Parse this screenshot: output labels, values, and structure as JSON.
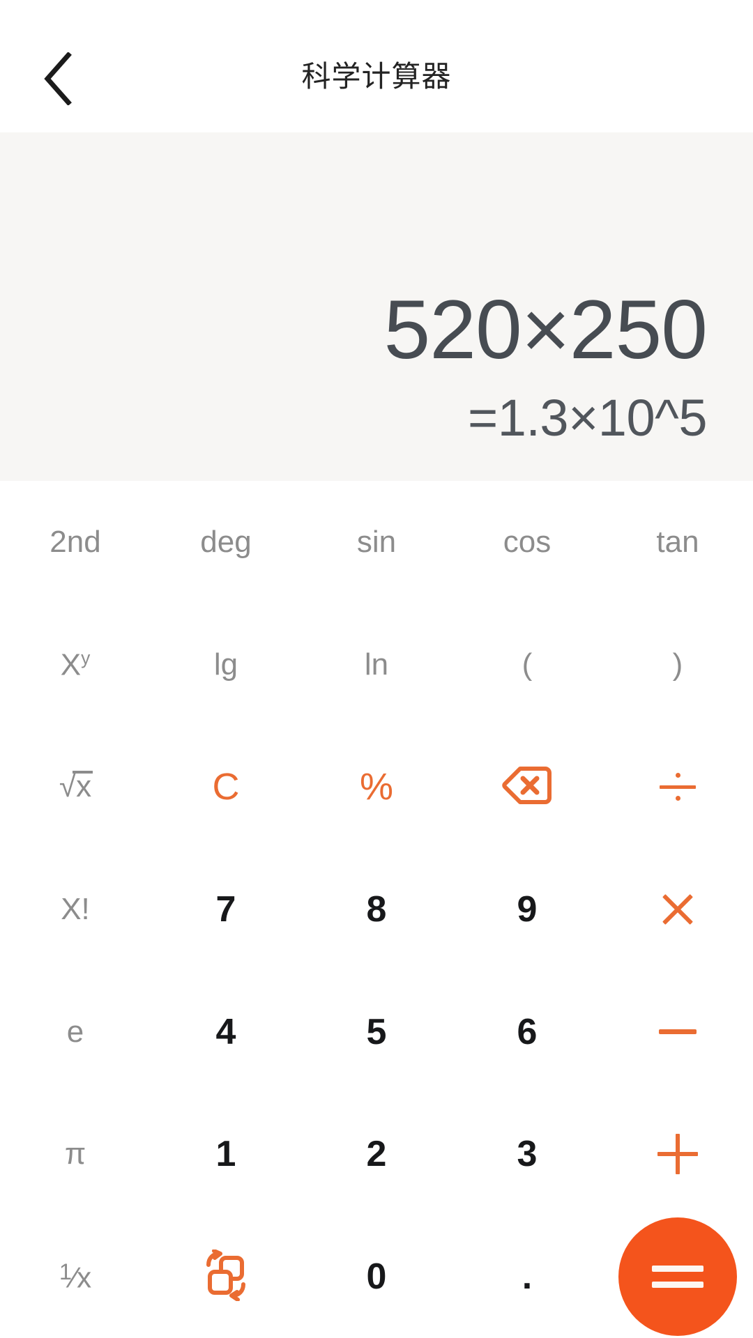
{
  "header": {
    "title": "科学计算器",
    "back_icon": "chevron-left-icon",
    "background": "#ffffff",
    "title_color": "#232323"
  },
  "display": {
    "expression": "520×250",
    "result": "=1.3×10^5",
    "background": "#f7f6f4",
    "expression_color": "#474c52",
    "result_color": "#51565c"
  },
  "theme": {
    "accent": "#ea6c32",
    "equals_accent": "#f4541c",
    "function_color": "#8c8c8c",
    "digit_color": "#17181a",
    "keypad_background": "#ffffff"
  },
  "keypad": {
    "rows": [
      [
        {
          "name": "key-2nd",
          "label": "2nd",
          "kind": "function"
        },
        {
          "name": "key-deg",
          "label": "deg",
          "kind": "function"
        },
        {
          "name": "key-sin",
          "label": "sin",
          "kind": "function"
        },
        {
          "name": "key-cos",
          "label": "cos",
          "kind": "function"
        },
        {
          "name": "key-tan",
          "label": "tan",
          "kind": "function"
        }
      ],
      [
        {
          "name": "key-power",
          "label": "X",
          "superscript": "y",
          "kind": "function"
        },
        {
          "name": "key-lg",
          "label": "lg",
          "kind": "function"
        },
        {
          "name": "key-ln",
          "label": "ln",
          "kind": "function"
        },
        {
          "name": "key-paren-open",
          "label": "(",
          "kind": "function"
        },
        {
          "name": "key-paren-close",
          "label": ")",
          "kind": "function"
        }
      ],
      [
        {
          "name": "key-sqrt",
          "label": "x",
          "kind": "function",
          "icon": "square-root-icon"
        },
        {
          "name": "key-clear",
          "label": "C",
          "kind": "operator"
        },
        {
          "name": "key-percent",
          "label": "%",
          "kind": "operator"
        },
        {
          "name": "key-backspace",
          "label": "",
          "kind": "operator",
          "icon": "backspace-icon"
        },
        {
          "name": "key-divide",
          "label": "÷",
          "kind": "operator",
          "icon": "divide-icon"
        }
      ],
      [
        {
          "name": "key-factorial",
          "label": "X!",
          "kind": "function"
        },
        {
          "name": "key-7",
          "label": "7",
          "kind": "digit"
        },
        {
          "name": "key-8",
          "label": "8",
          "kind": "digit"
        },
        {
          "name": "key-9",
          "label": "9",
          "kind": "digit"
        },
        {
          "name": "key-multiply",
          "label": "×",
          "kind": "operator",
          "icon": "multiply-icon"
        }
      ],
      [
        {
          "name": "key-e",
          "label": "e",
          "kind": "function"
        },
        {
          "name": "key-4",
          "label": "4",
          "kind": "digit"
        },
        {
          "name": "key-5",
          "label": "5",
          "kind": "digit"
        },
        {
          "name": "key-6",
          "label": "6",
          "kind": "digit"
        },
        {
          "name": "key-subtract",
          "label": "−",
          "kind": "operator",
          "icon": "minus-icon"
        }
      ],
      [
        {
          "name": "key-pi",
          "label": "π",
          "kind": "function"
        },
        {
          "name": "key-1",
          "label": "1",
          "kind": "digit"
        },
        {
          "name": "key-2",
          "label": "2",
          "kind": "digit"
        },
        {
          "name": "key-3",
          "label": "3",
          "kind": "digit"
        },
        {
          "name": "key-add",
          "label": "+",
          "kind": "operator",
          "icon": "plus-icon"
        }
      ],
      [
        {
          "name": "key-reciprocal",
          "label": "1/x",
          "kind": "function",
          "icon": "reciprocal-icon"
        },
        {
          "name": "key-convert",
          "label": "",
          "kind": "operator",
          "icon": "swap-units-icon"
        },
        {
          "name": "key-0",
          "label": "0",
          "kind": "digit"
        },
        {
          "name": "key-decimal",
          "label": ".",
          "kind": "digit"
        },
        {
          "name": "key-equals",
          "label": "=",
          "kind": "equals",
          "icon": "equals-icon"
        }
      ]
    ]
  }
}
